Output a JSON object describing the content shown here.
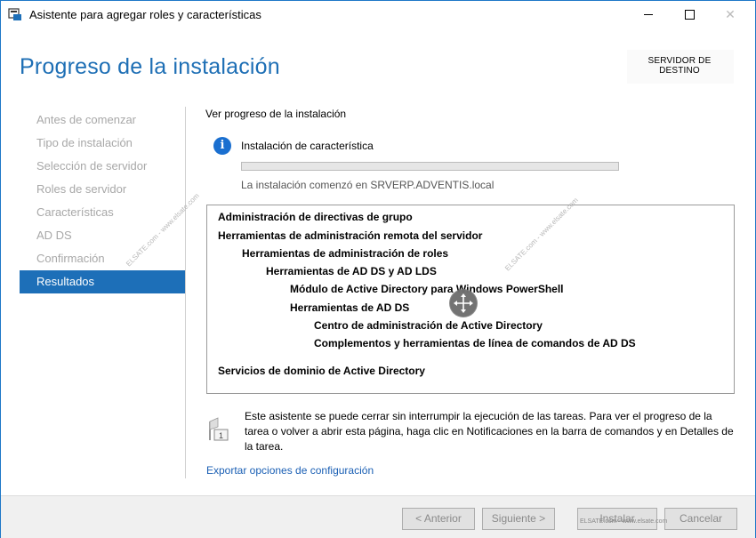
{
  "window": {
    "title": "Asistente para agregar roles y características",
    "close_glyph": "✕"
  },
  "page_title": "Progreso de la instalación",
  "destination_server": {
    "label": "SERVIDOR DE DESTINO"
  },
  "nav": {
    "items": [
      {
        "label": "Antes de comenzar"
      },
      {
        "label": "Tipo de instalación"
      },
      {
        "label": "Selección de servidor"
      },
      {
        "label": "Roles de servidor"
      },
      {
        "label": "Características"
      },
      {
        "label": "AD DS"
      },
      {
        "label": "Confirmación"
      },
      {
        "label": "Resultados"
      }
    ],
    "active_index": 7
  },
  "main": {
    "view_progress": "Ver progreso de la instalación",
    "info_icon_glyph": "i",
    "feature_install": "Instalación de característica",
    "progress_fraction": 0.0,
    "install_started": "La instalación comenzó en SRVERP.ADVENTIS.local",
    "results": [
      {
        "label": "Administración de directivas de grupo",
        "level": 0
      },
      {
        "label": "Herramientas de administración remota del servidor",
        "level": 0
      },
      {
        "label": "Herramientas de administración de roles",
        "level": 1
      },
      {
        "label": "Herramientas de AD DS y AD LDS",
        "level": 2
      },
      {
        "label": "Módulo de Active Directory para Windows PowerShell",
        "level": 3
      },
      {
        "label": "Herramientas de AD DS",
        "level": 3
      },
      {
        "label": "Centro de administración de Active Directory",
        "level": 4
      },
      {
        "label": "Complementos y herramientas de línea de comandos de AD DS",
        "level": 4
      },
      {
        "label": "Servicios de dominio de Active Directory",
        "level": 0
      }
    ],
    "note": "Este asistente se puede cerrar sin interrumpir la ejecución de las tareas. Para ver el progreso de la tarea o volver a abrir esta página, haga clic en Notificaciones en la barra de comandos y en Detalles de la tarea.",
    "notification_badge": "1",
    "export_link": "Exportar opciones de configuración"
  },
  "footer": {
    "back_label": "< Anterior",
    "next_label": "Siguiente >",
    "install_label": "Instalar",
    "cancel_label": "Cancelar"
  },
  "watermark": {
    "text": "ELSATE.com - www.elsate.com",
    "footer_text": "ELSATE.com - www.elsate.com"
  },
  "colors": {
    "accent": "#1d6fb8",
    "title": "#1e6fb5",
    "link": "#1a5fb4",
    "info": "#1a6fd0",
    "progress": "#06b025"
  }
}
